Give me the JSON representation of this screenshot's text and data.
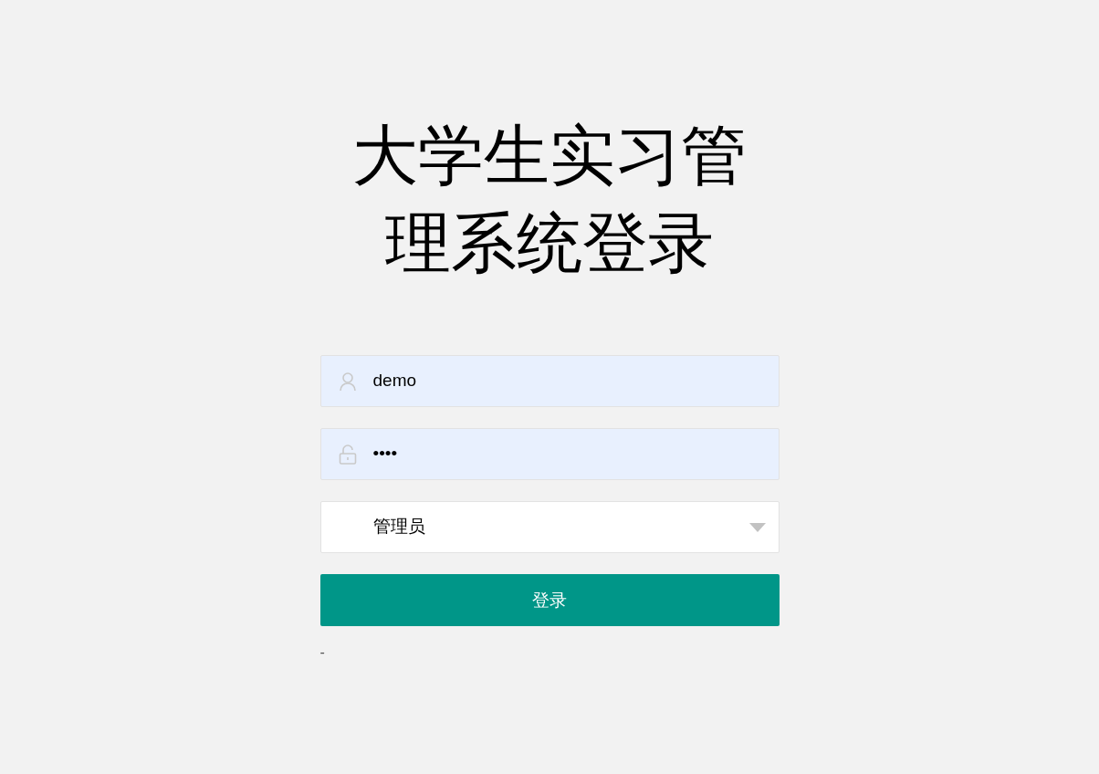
{
  "title": "大学生实习管理系统登录",
  "username": {
    "value": "demo"
  },
  "password": {
    "value": "••••"
  },
  "role": {
    "value": "管理员"
  },
  "login_button": "登录",
  "footer": "-"
}
